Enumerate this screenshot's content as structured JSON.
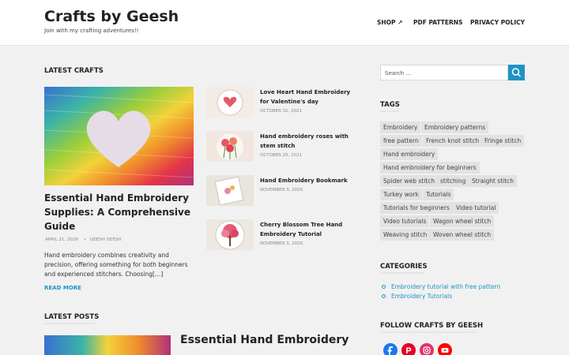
{
  "header": {
    "site_title": "Crafts by Geesh",
    "tagline": "Join with my crafting adventures!!",
    "nav": [
      "SHOP ↗",
      "PDF PATTERNS",
      "PRIVACY POLICY"
    ]
  },
  "latest_crafts": {
    "heading": "LATEST CRAFTS",
    "featured": {
      "title": "Essential Hand Embroidery Supplies: A Comprehensive Guide",
      "date": "APRIL 21, 2026",
      "author": "GEESH GEESH",
      "excerpt": "Hand embroidery combines creativity and precision, offering something for both beginners and experienced stitchers. Choosing[…]",
      "read_more": "READ MORE"
    },
    "small_posts": [
      {
        "title": "Love Heart Hand Embroidery for Valentine's day",
        "date": "OCTOBER 31, 2021"
      },
      {
        "title": "Hand embroidery roses with stem stitch",
        "date": "OCTOBER 25, 2021"
      },
      {
        "title": "Hand Embroidery Bookmark",
        "date": "NOVEMBER 3, 2020"
      },
      {
        "title": "Cherry Blossom Tree Hand Embroidery Tutorial",
        "date": "NOVEMBER 3, 2020"
      }
    ]
  },
  "latest_posts": {
    "heading": "LATEST POSTS",
    "first_title": "Essential Hand Embroidery"
  },
  "sidebar": {
    "search_placeholder": "Search …",
    "tags_heading": "TAGS",
    "tags": [
      "Embroidery",
      "Embroidery patterns",
      "free pattern",
      "French knot stitch",
      "Fringe stitch",
      "Hand embroidery",
      "Hand embroidery for beginners",
      "Spider web stitch",
      "stitching",
      "Straight stitch",
      "Turkey work",
      "Tutorials",
      "Tutorials for beginners",
      "Video tutorial",
      "Video tutorials",
      "Wagon wheel stitch",
      "Weaving stitch",
      "Woven wheel stitch"
    ],
    "categories_heading": "CATEGORIES",
    "categories": [
      "Embroidery tutorial with free pattern",
      "Embroidery Tutorials"
    ],
    "follow_heading": "FOLLOW CRAFTS BY GEESH",
    "socials": [
      {
        "icon": "facebook-icon",
        "color": "#1877f2"
      },
      {
        "icon": "pinterest-icon",
        "color": "#e60023"
      },
      {
        "icon": "instagram-icon",
        "color": "#e1306c"
      },
      {
        "icon": "youtube-icon",
        "color": "#ff0000"
      }
    ]
  },
  "colors": {
    "accent": "#1e93c4"
  }
}
